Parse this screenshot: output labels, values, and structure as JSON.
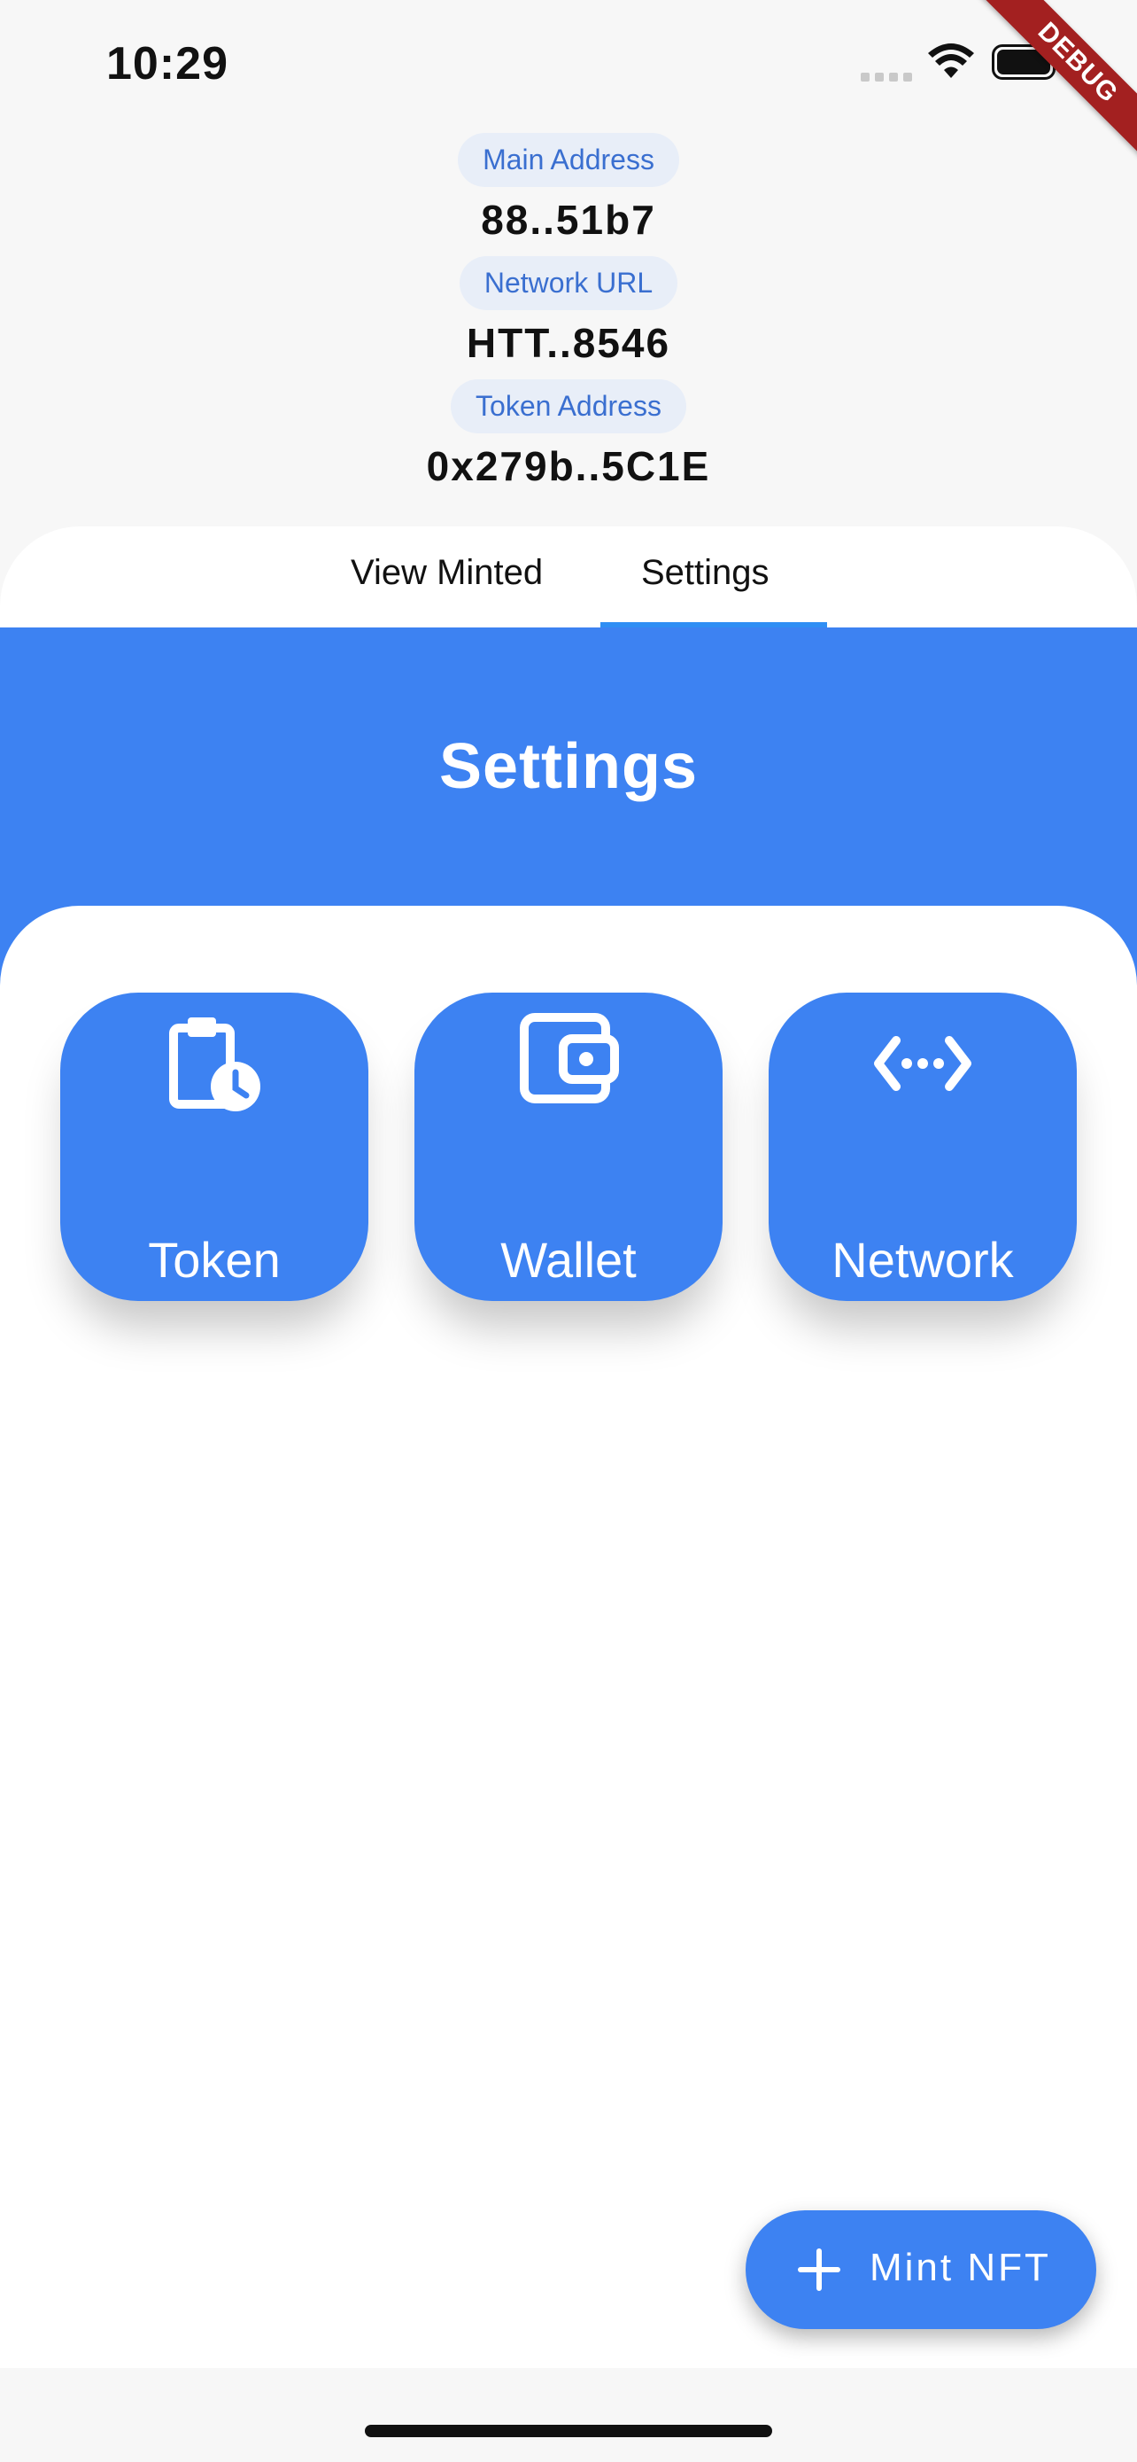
{
  "status_bar": {
    "time": "10:29"
  },
  "debug_banner": "DEBUG",
  "info": {
    "main_address_label": "Main Address",
    "main_address_value": "88..51b7",
    "network_url_label": "Network URL",
    "network_url_value": "HTT..8546",
    "token_address_label": "Token Address",
    "token_address_value": "0x279b..5C1E"
  },
  "tabs": [
    {
      "label": "View Minted",
      "selected": false
    },
    {
      "label": "Settings",
      "selected": true
    }
  ],
  "header": {
    "title": "Settings"
  },
  "cards": [
    {
      "label": "Token",
      "icon": "clipboard-clock-icon"
    },
    {
      "label": "Wallet",
      "icon": "wallet-icon"
    },
    {
      "label": "Network",
      "icon": "network-code-icon"
    }
  ],
  "fab": {
    "label": "Mint NFT",
    "icon": "plus-icon"
  },
  "colors": {
    "primary": "#3d82f2",
    "chip_bg": "#e8eef8",
    "chip_text": "#3a6fd0",
    "indicator": "#2f8ef4",
    "debug": "#a32020"
  }
}
